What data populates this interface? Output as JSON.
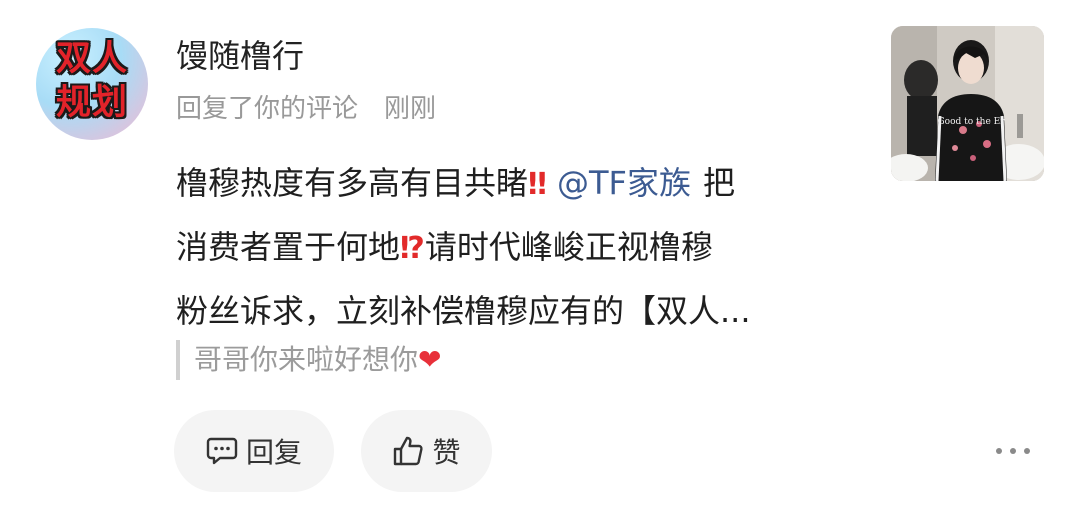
{
  "comment": {
    "avatar_text": [
      "双人",
      "规划"
    ],
    "username": "馒随橹行",
    "action": "回复了你的评论",
    "time": "刚刚",
    "text_lines": [
      "橹穆热度有多高有目共睹",
      "消费者置于何地",
      "请时代峰峻正视橹穆",
      "粉丝诉求，立刻补偿橹穆应有的【双人..."
    ],
    "mention": "@TF家族",
    "text_after_mention": "把",
    "emoji_double_exclaim": "‼",
    "emoji_exclaim_question": "⁉",
    "quoted_text": "哥哥你来啦好想你",
    "quoted_emoji": "❤",
    "thumbnail_text": "Good to the Er"
  },
  "actions": {
    "reply_label": "回复",
    "like_label": "赞"
  },
  "icons": {
    "reply": "comment-icon",
    "like": "thumbs-up-icon",
    "more": "more-dots-icon"
  },
  "colors": {
    "mention": "#3c5b92",
    "emoji_red": "#e22a2a",
    "quote_bar": "#d0d0d0",
    "button_bg": "#f4f4f4"
  }
}
